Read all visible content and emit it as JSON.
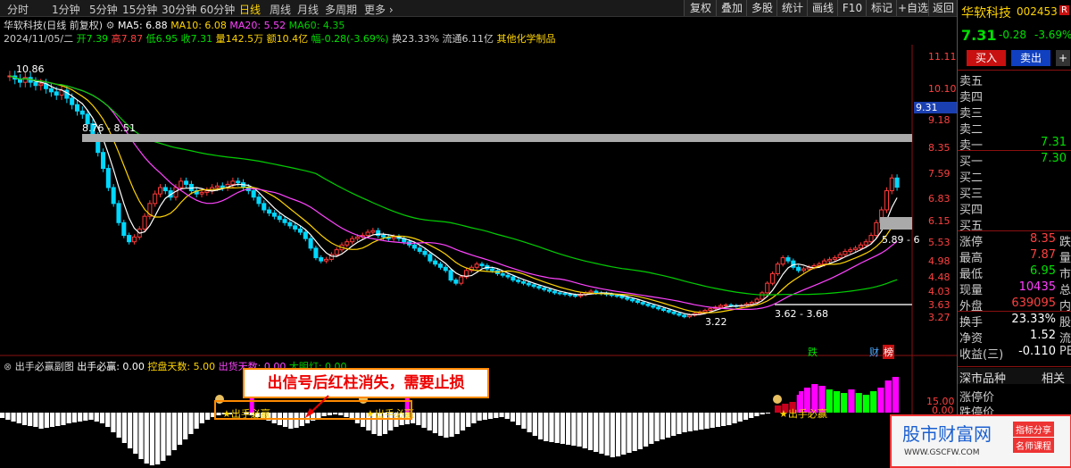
{
  "toolbar": {
    "periods": [
      "分时",
      "1分钟",
      "5分钟",
      "15分钟",
      "30分钟",
      "60分钟",
      "日线",
      "周线",
      "月线",
      "多周期",
      "更多 ›"
    ],
    "active_period": "日线",
    "tools": [
      "复权",
      "叠加",
      "多股",
      "统计",
      "画线",
      "F10",
      "标记",
      "+自选",
      "返回"
    ]
  },
  "stock": {
    "name": "华软科技",
    "code": "002453",
    "code_suffix": "R",
    "price": "7.31",
    "change": "-0.28",
    "change_pct": "-3.69%"
  },
  "ma_line": {
    "title": "华软科技(日线 前复权)",
    "ma5": "MA5: 6.88",
    "ma10": "MA10: 6.08",
    "ma20": "MA20: 5.52",
    "ma60": "MA60: 4.35"
  },
  "quote_line": {
    "date": "2024/11/05/二",
    "open": "开7.39",
    "high": "高7.87",
    "low": "低6.95",
    "close": "收7.31",
    "volume": "量142.5万",
    "amount": "额10.4亿",
    "amplitude": "幅-0.28(-3.69%)",
    "turnover": "换23.33%",
    "float_cap": "流通6.11亿",
    "industry": "其他化学制品"
  },
  "price_axis": [
    "11.11",
    "10.10",
    "9.18",
    "8.35",
    "7.59",
    "6.83",
    "6.15",
    "5.53",
    "4.98",
    "4.48",
    "4.03",
    "3.63",
    "3.27"
  ],
  "price_axis_highlight": "9.31",
  "chart_annotations": {
    "high_label": "10.86",
    "band_label": "8.76 - 8.51",
    "right_band_label": "5.89 - 6",
    "low_label": "3.22",
    "low_band_label": "3.62 - 3.68",
    "tag_die": "跌",
    "tag_cai": "财",
    "tag_bang": "榜"
  },
  "indicator": {
    "name": "出手必赢副图",
    "val1": "出手必赢: 0.00",
    "val2": "控盘天数: 5.00",
    "val3": "出货天数: 0.00",
    "val4": "大明灯: 0.00",
    "axis": [
      "15.00",
      "0.00"
    ],
    "signal_label": "★出手必赢",
    "note": "出信号后红柱消失，需要止损"
  },
  "indicator_data": {
    "histogram": [
      -6,
      -8,
      -10,
      -12,
      -14,
      -15,
      -16,
      -18,
      -17,
      -16,
      -15,
      -14,
      -12,
      -11,
      -10,
      -9,
      -8,
      -10,
      -12,
      -16,
      -22,
      -28,
      -34,
      -40,
      -46,
      -52,
      -57,
      -60,
      -58,
      -54,
      -48,
      -42,
      -36,
      -30,
      -24,
      -18,
      -12,
      -8,
      -5,
      -3,
      -2,
      -2,
      -1,
      0,
      -2,
      -3,
      -5,
      -7,
      -9,
      -12,
      -14,
      -16,
      -18,
      -17,
      -15,
      -12,
      -9,
      -6,
      -4,
      -3,
      -2,
      -3,
      -5,
      -8,
      -12,
      -16,
      -20,
      -24,
      -26,
      -24,
      -20,
      -16,
      -14,
      -13,
      -12,
      -14,
      -17,
      -20,
      -23,
      -26,
      -28,
      -27,
      -24,
      -20,
      -16,
      -12,
      -9,
      -8,
      -7,
      -6,
      -5,
      -7,
      -10,
      -14,
      -18,
      -22,
      -26,
      -30,
      -32,
      -33,
      -34,
      -35,
      -36,
      -37,
      -38,
      -40,
      -42,
      -44,
      -46,
      -48,
      -50,
      -49,
      -47,
      -45,
      -43,
      -41,
      -38,
      -35,
      -32,
      -30,
      -28,
      -26,
      -24,
      -22,
      -21,
      -20,
      -19,
      -18,
      -17,
      -16,
      -15,
      -14,
      -12,
      -10,
      -8,
      -6,
      -4,
      -2,
      -1
    ],
    "signals": [
      {
        "index": 45,
        "height": 24
      },
      {
        "index": 73,
        "height": 24
      },
      {
        "index": 144,
        "height": 24
      }
    ],
    "right_bars": [
      {
        "value": 8,
        "color": "#c8001e"
      },
      {
        "value": 10,
        "color": "#c8001e"
      },
      {
        "value": 12,
        "color": "#c8001e"
      },
      {
        "value": 20,
        "color": "#ff00ff"
      },
      {
        "value": 28,
        "color": "#ff00ff"
      },
      {
        "value": 32,
        "color": "#ff00ff"
      },
      {
        "value": 30,
        "color": "#ff00ff"
      },
      {
        "value": 26,
        "color": "#00ff00"
      },
      {
        "value": 24,
        "color": "#00ff00"
      },
      {
        "value": 22,
        "color": "#00ff00"
      },
      {
        "value": 26,
        "color": "#ff00ff"
      },
      {
        "value": 22,
        "color": "#00ff00"
      },
      {
        "value": 20,
        "color": "#00ff00"
      },
      {
        "value": 24,
        "color": "#00ff00"
      },
      {
        "value": 28,
        "color": "#ff00ff"
      },
      {
        "value": 36,
        "color": "#ff00ff"
      },
      {
        "value": 40,
        "color": "#ff00ff"
      }
    ]
  },
  "kline": {
    "ylim": [
      3.1,
      11.5
    ],
    "count": 174,
    "closes": [
      10.8,
      10.7,
      10.6,
      10.75,
      10.6,
      10.5,
      10.55,
      10.4,
      10.3,
      10.2,
      10.35,
      10.1,
      9.9,
      9.7,
      9.6,
      9.3,
      8.9,
      8.4,
      7.9,
      7.3,
      6.8,
      6.2,
      5.8,
      5.6,
      5.75,
      6.0,
      6.4,
      6.8,
      7.1,
      7.3,
      7.2,
      7.0,
      7.3,
      7.5,
      7.4,
      7.2,
      7.1,
      7.15,
      7.2,
      7.3,
      7.35,
      7.3,
      7.4,
      7.5,
      7.45,
      7.3,
      7.2,
      7.0,
      6.8,
      6.6,
      6.5,
      6.4,
      6.3,
      6.2,
      6.1,
      6.0,
      5.9,
      5.7,
      5.4,
      5.1,
      5.0,
      5.05,
      5.2,
      5.35,
      5.5,
      5.6,
      5.7,
      5.75,
      5.8,
      5.9,
      5.95,
      5.8,
      5.75,
      5.7,
      5.75,
      5.7,
      5.6,
      5.5,
      5.4,
      5.3,
      5.2,
      5.0,
      4.9,
      4.8,
      4.7,
      4.4,
      4.3,
      4.5,
      4.7,
      4.8,
      4.9,
      4.85,
      4.75,
      4.7,
      4.6,
      4.55,
      4.5,
      4.4,
      4.35,
      4.3,
      4.25,
      4.2,
      4.15,
      4.1,
      4.05,
      4.0,
      3.98,
      3.95,
      3.92,
      3.9,
      3.95,
      4.0,
      4.05,
      4.0,
      3.98,
      3.95,
      3.92,
      3.9,
      3.85,
      3.8,
      3.75,
      3.7,
      3.65,
      3.6,
      3.55,
      3.5,
      3.45,
      3.4,
      3.35,
      3.3,
      3.25,
      3.3,
      3.35,
      3.4,
      3.45,
      3.5,
      3.55,
      3.6,
      3.62,
      3.6,
      3.58,
      3.6,
      3.65,
      3.7,
      3.8,
      4.0,
      4.3,
      4.6,
      4.9,
      5.1,
      5.0,
      4.8,
      4.7,
      4.75,
      4.8,
      4.85,
      4.9,
      5.0,
      5.05,
      5.1,
      5.2,
      5.3,
      5.35,
      5.4,
      5.5,
      5.6,
      5.8,
      6.2,
      6.6,
      7.2,
      7.6,
      7.31
    ]
  },
  "quotes_panel": {
    "sell": [
      {
        "label": "卖五",
        "price": ""
      },
      {
        "label": "卖四",
        "price": ""
      },
      {
        "label": "卖三",
        "price": ""
      },
      {
        "label": "卖二",
        "price": ""
      },
      {
        "label": "卖一",
        "price": "7.31"
      }
    ],
    "buy": [
      {
        "label": "买一",
        "price": "7.30"
      },
      {
        "label": "买二",
        "price": ""
      },
      {
        "label": "买三",
        "price": ""
      },
      {
        "label": "买四",
        "price": ""
      },
      {
        "label": "买五",
        "price": ""
      }
    ],
    "stats": [
      {
        "label": "涨停",
        "value": "8.35",
        "suffix": "跌",
        "color": "#ff4040"
      },
      {
        "label": "最高",
        "value": "7.87",
        "suffix": "量",
        "color": "#ff4040"
      },
      {
        "label": "最低",
        "value": "6.95",
        "suffix": "市",
        "color": "#00e000"
      },
      {
        "label": "现量",
        "value": "10435",
        "suffix": "总",
        "color": "#ff40ff"
      },
      {
        "label": "外盘",
        "value": "639095",
        "suffix": "内",
        "color": "#ff4040"
      }
    ],
    "stats2": [
      {
        "label": "换手",
        "value": "23.33%",
        "suffix": "股",
        "color": "#ffffff"
      },
      {
        "label": "净资",
        "value": "1.52",
        "suffix": "流",
        "color": "#ffffff"
      },
      {
        "label": "收益(三)",
        "value": "-0.110",
        "suffix": "PE",
        "color": "#ffffff"
      }
    ],
    "buy_button": "买入",
    "sell_button": "卖出",
    "sector_title": "深市品种",
    "related": "相关",
    "extra": [
      "涨停价",
      "跌停价"
    ]
  },
  "watermark": {
    "title": "股市财富网",
    "tag1": "指标分享",
    "tag2": "名师课程",
    "url": "WWW.GSCFW.COM"
  }
}
